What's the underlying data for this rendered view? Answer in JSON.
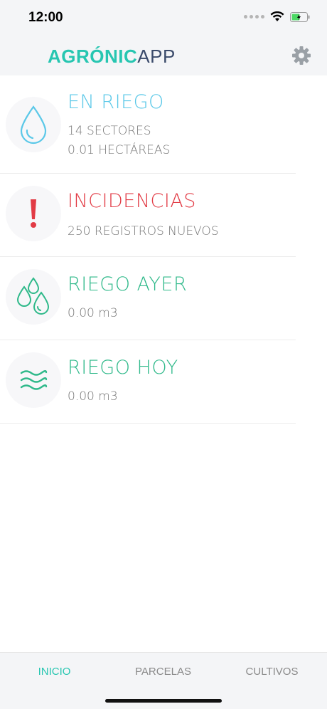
{
  "status_bar": {
    "time": "12:00"
  },
  "header": {
    "logo_strong": "AGRÓNIC",
    "logo_light": "APP",
    "settings_icon": "gear-icon"
  },
  "colors": {
    "accent": "#27c6b1",
    "riego_blue": "#5bc8e8",
    "alert_red": "#e23b45",
    "green": "#2fb98a"
  },
  "items": [
    {
      "icon": "water-drop-icon",
      "title": "EN RIEGO",
      "lines": [
        "14 SECTORES",
        "0.01 HECTÁREAS"
      ]
    },
    {
      "icon": "exclamation-icon",
      "title": "INCIDENCIAS",
      "lines": [
        "250 REGISTROS NUEVOS"
      ]
    },
    {
      "icon": "water-drops-icon",
      "title": "RIEGO AYER",
      "lines": [
        "0.00 m3"
      ]
    },
    {
      "icon": "waves-icon",
      "title": "RIEGO HOY",
      "lines": [
        "0.00 m3"
      ]
    }
  ],
  "tabs": [
    {
      "label": "INICIO",
      "active": true
    },
    {
      "label": "PARCELAS",
      "active": false
    },
    {
      "label": "CULTIVOS",
      "active": false
    }
  ]
}
